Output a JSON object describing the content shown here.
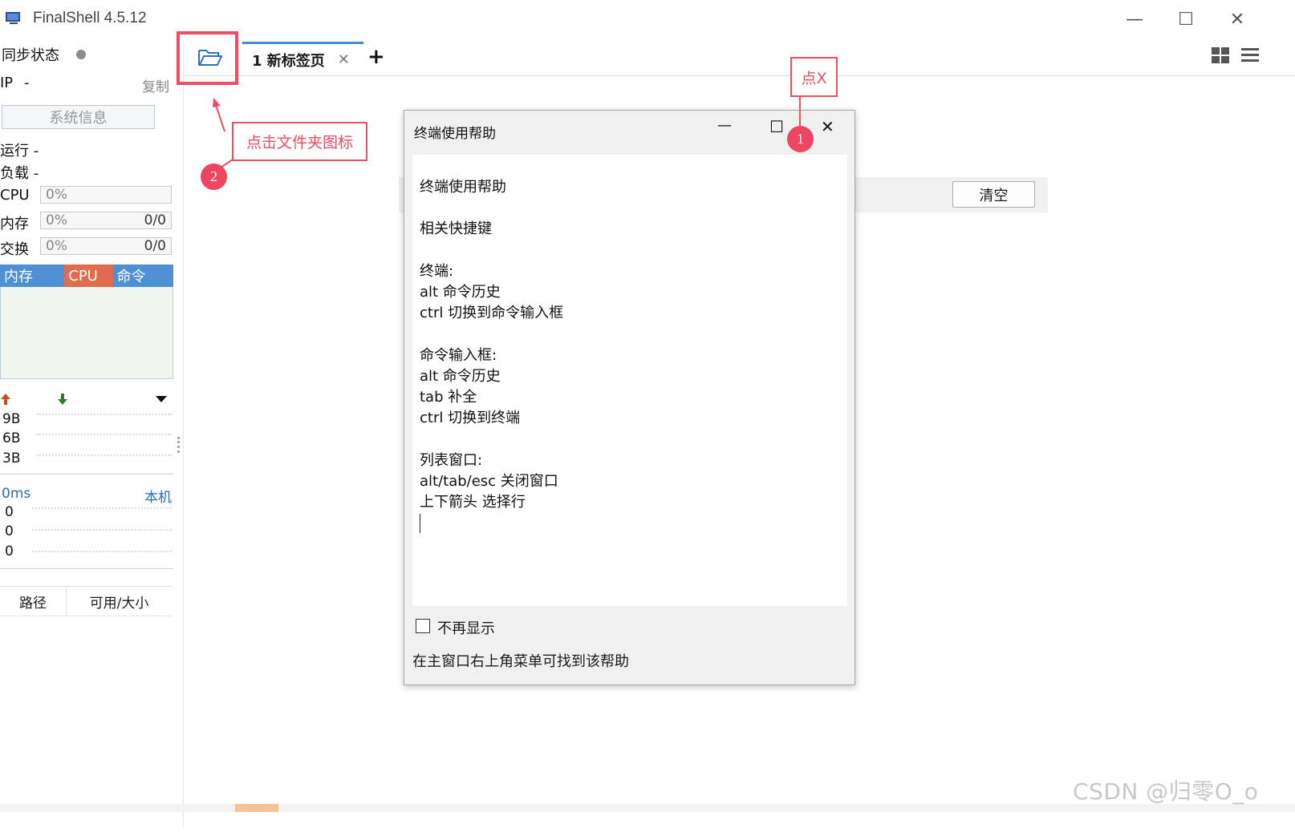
{
  "window": {
    "title": "FinalShell 4.5.12",
    "minimize": "—",
    "maximize": "☐",
    "close": "✕"
  },
  "sidebar": {
    "sync_label": "同步状态",
    "ip_label": "IP",
    "ip_value": "-",
    "copy_label": "复制",
    "sysinfo_button": "系统信息",
    "run_label": "运行 -",
    "load_label": "负载 -",
    "cpu_label": "CPU",
    "cpu_value": "0%",
    "mem_label": "内存",
    "mem_value": "0%",
    "mem_extra": "0/0",
    "swap_label": "交换",
    "swap_value": "0%",
    "swap_extra": "0/0",
    "proc_tabs": [
      {
        "label": "内存",
        "color": "#4f8fd3"
      },
      {
        "label": "CPU",
        "color": "#e06b4f"
      },
      {
        "label": "命令",
        "color": "#4f8fd3"
      }
    ],
    "net_levels": [
      "9B",
      "6B",
      "3B"
    ],
    "ping_label": "0ms",
    "host_label": "本机",
    "ping_values": [
      "0",
      "0",
      "0"
    ],
    "path_col": "路径",
    "size_col": "可用/大小"
  },
  "tabs": [
    {
      "label": "1 新标签页"
    }
  ],
  "tab_close": "✕",
  "add_tab": "+",
  "clear_button": "清空",
  "annotations": {
    "step1_label": "点X",
    "step1_num": "1",
    "step2_label": "点击文件夹图标",
    "step2_num": "2",
    "color": "#ef4c65"
  },
  "dialog": {
    "title": "终端使用帮助",
    "minimize": "—",
    "maximize": "☐",
    "close": "✕",
    "lines": [
      "终端使用帮助",
      "",
      "相关快捷键",
      "",
      "终端:",
      "alt 命令历史",
      "ctrl 切换到命令输入框",
      "",
      "命令输入框:",
      "alt 命令历史",
      "tab 补全",
      "ctrl 切换到终端",
      "",
      "列表窗口:",
      "alt/tab/esc 关闭窗口",
      "上下箭头 选择行"
    ],
    "dont_show": "不再显示",
    "footer": "在主窗口右上角菜单可找到该帮助"
  },
  "watermark": "CSDN @归零O_o"
}
